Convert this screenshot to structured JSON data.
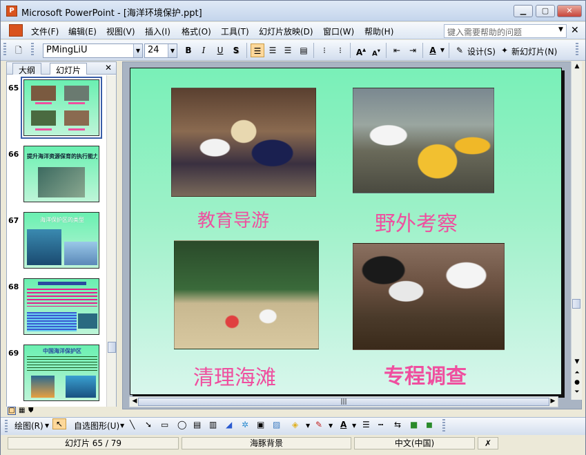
{
  "window": {
    "title": "Microsoft PowerPoint - [海洋环境保护.ppt]",
    "app_icon_label": "P"
  },
  "menu": {
    "items": [
      "文件(F)",
      "编辑(E)",
      "视图(V)",
      "插入(I)",
      "格式(O)",
      "工具(T)",
      "幻灯片放映(D)",
      "窗口(W)",
      "帮助(H)"
    ],
    "help_placeholder": "键入需要帮助的问题"
  },
  "toolbar": {
    "font_name": "PMingLiU",
    "font_size": "24",
    "bold": "B",
    "italic": "I",
    "underline": "U",
    "shadow": "S",
    "design_label": "设计(S)",
    "new_slide_label": "新幻灯片(N)"
  },
  "panel": {
    "tabs": [
      "大纲",
      "幻灯片"
    ],
    "thumbnails": [
      {
        "number": "65",
        "selected": true
      },
      {
        "number": "66",
        "title": "提升海洋资源保育的执行能力"
      },
      {
        "number": "67",
        "title": "海洋保护区的类型"
      },
      {
        "number": "68"
      },
      {
        "number": "69",
        "title": "中国海洋保护区"
      }
    ]
  },
  "slide": {
    "captions": [
      "教育导游",
      "野外考察",
      "清理海滩",
      "专程调查"
    ]
  },
  "drawbar": {
    "draw_label": "绘图(R)",
    "autoshape_label": "自选图形(U)"
  },
  "status": {
    "slide_info": "幻灯片 65 / 79",
    "design": "海豚背景",
    "language": "中文(中国)"
  },
  "colors": {
    "slide_top": "#79f0b8",
    "slide_bottom": "#d8f6ec",
    "caption": "#ef4f9f"
  }
}
